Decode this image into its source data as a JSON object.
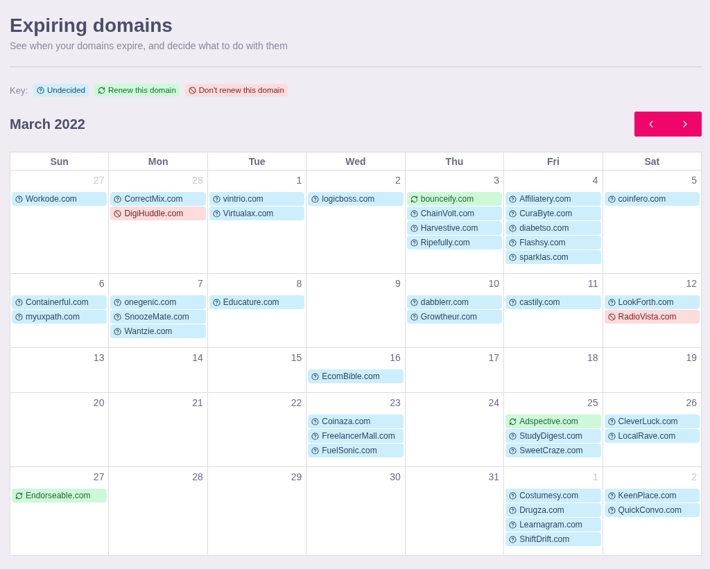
{
  "header": {
    "title": "Expiring domains",
    "subtitle": "See when your domains expire, and decide what to do with them"
  },
  "key": {
    "label": "Key:",
    "items": [
      {
        "kind": "undecided",
        "label": "Undecided"
      },
      {
        "kind": "renew",
        "label": "Renew this domain"
      },
      {
        "kind": "dont_renew",
        "label": "Don't renew this domain"
      }
    ]
  },
  "calendar": {
    "month": "March 2022",
    "weekdays": [
      "Sun",
      "Mon",
      "Tue",
      "Wed",
      "Thu",
      "Fri",
      "Sat"
    ],
    "weeks": [
      [
        {
          "day": "27",
          "in_month": false,
          "domains": [
            {
              "kind": "undecided",
              "name": "Workode.com"
            }
          ]
        },
        {
          "day": "28",
          "in_month": false,
          "domains": [
            {
              "kind": "undecided",
              "name": "CorrectMix.com"
            },
            {
              "kind": "dont_renew",
              "name": "DigiHuddle.com"
            }
          ]
        },
        {
          "day": "1",
          "in_month": true,
          "domains": [
            {
              "kind": "undecided",
              "name": "vintrio.com"
            },
            {
              "kind": "undecided",
              "name": "Virtualax.com"
            }
          ]
        },
        {
          "day": "2",
          "in_month": true,
          "domains": [
            {
              "kind": "undecided",
              "name": "logicboss.com"
            }
          ]
        },
        {
          "day": "3",
          "in_month": true,
          "domains": [
            {
              "kind": "renew",
              "name": "bounceify.com"
            },
            {
              "kind": "undecided",
              "name": "ChainVolt.com"
            },
            {
              "kind": "undecided",
              "name": "Harvestive.com"
            },
            {
              "kind": "undecided",
              "name": "Ripefully.com"
            }
          ]
        },
        {
          "day": "4",
          "in_month": true,
          "domains": [
            {
              "kind": "undecided",
              "name": "Affiliatery.com"
            },
            {
              "kind": "undecided",
              "name": "CuraByte.com"
            },
            {
              "kind": "undecided",
              "name": "diabetso.com"
            },
            {
              "kind": "undecided",
              "name": "Flashsy.com"
            },
            {
              "kind": "undecided",
              "name": "sparklas.com"
            }
          ]
        },
        {
          "day": "5",
          "in_month": true,
          "domains": [
            {
              "kind": "undecided",
              "name": "coinfero.com"
            }
          ]
        }
      ],
      [
        {
          "day": "6",
          "in_month": true,
          "domains": [
            {
              "kind": "undecided",
              "name": "Containerful.com"
            },
            {
              "kind": "undecided",
              "name": "myuxpath.com"
            }
          ]
        },
        {
          "day": "7",
          "in_month": true,
          "domains": [
            {
              "kind": "undecided",
              "name": "onegenic.com"
            },
            {
              "kind": "undecided",
              "name": "SnoozeMate.com"
            },
            {
              "kind": "undecided",
              "name": "Wantzie.com"
            }
          ]
        },
        {
          "day": "8",
          "in_month": true,
          "domains": [
            {
              "kind": "undecided",
              "name": "Educature.com"
            }
          ]
        },
        {
          "day": "9",
          "in_month": true
        },
        {
          "day": "10",
          "in_month": true,
          "domains": [
            {
              "kind": "undecided",
              "name": "dabblerr.com"
            },
            {
              "kind": "undecided",
              "name": "Growtheur.com"
            }
          ]
        },
        {
          "day": "11",
          "in_month": true,
          "domains": [
            {
              "kind": "undecided",
              "name": "castily.com"
            }
          ]
        },
        {
          "day": "12",
          "in_month": true,
          "domains": [
            {
              "kind": "undecided",
              "name": "LookForth.com"
            },
            {
              "kind": "dont_renew",
              "name": "RadioVista.com"
            }
          ]
        }
      ],
      [
        {
          "day": "13",
          "in_month": true
        },
        {
          "day": "14",
          "in_month": true
        },
        {
          "day": "15",
          "in_month": true
        },
        {
          "day": "16",
          "in_month": true,
          "domains": [
            {
              "kind": "undecided",
              "name": "EcomBible.com"
            }
          ]
        },
        {
          "day": "17",
          "in_month": true
        },
        {
          "day": "18",
          "in_month": true
        },
        {
          "day": "19",
          "in_month": true
        }
      ],
      [
        {
          "day": "20",
          "in_month": true
        },
        {
          "day": "21",
          "in_month": true
        },
        {
          "day": "22",
          "in_month": true
        },
        {
          "day": "23",
          "in_month": true,
          "domains": [
            {
              "kind": "undecided",
              "name": "Coinaza.com"
            },
            {
              "kind": "undecided",
              "name": "FreelancerMall.com"
            },
            {
              "kind": "undecided",
              "name": "FuelSonic.com"
            }
          ]
        },
        {
          "day": "24",
          "in_month": true
        },
        {
          "day": "25",
          "in_month": true,
          "domains": [
            {
              "kind": "renew",
              "name": "Adspective.com"
            },
            {
              "kind": "undecided",
              "name": "StudyDigest.com"
            },
            {
              "kind": "undecided",
              "name": "SweetCraze.com"
            }
          ]
        },
        {
          "day": "26",
          "in_month": true,
          "domains": [
            {
              "kind": "undecided",
              "name": "CleverLuck.com"
            },
            {
              "kind": "undecided",
              "name": "LocalRave.com"
            }
          ]
        }
      ],
      [
        {
          "day": "27",
          "in_month": true,
          "domains": [
            {
              "kind": "renew",
              "name": "Endorseable.com"
            }
          ]
        },
        {
          "day": "28",
          "in_month": true
        },
        {
          "day": "29",
          "in_month": true
        },
        {
          "day": "30",
          "in_month": true
        },
        {
          "day": "31",
          "in_month": true
        },
        {
          "day": "1",
          "in_month": false,
          "domains": [
            {
              "kind": "undecided",
              "name": "Costumesy.com"
            },
            {
              "kind": "undecided",
              "name": "Drugza.com"
            },
            {
              "kind": "undecided",
              "name": "Learnagram.com"
            },
            {
              "kind": "undecided",
              "name": "ShiftDrift.com"
            }
          ]
        },
        {
          "day": "2",
          "in_month": false,
          "domains": [
            {
              "kind": "undecided",
              "name": "KeenPlace.com"
            },
            {
              "kind": "undecided",
              "name": "QuickConvo.com"
            }
          ]
        }
      ]
    ]
  }
}
